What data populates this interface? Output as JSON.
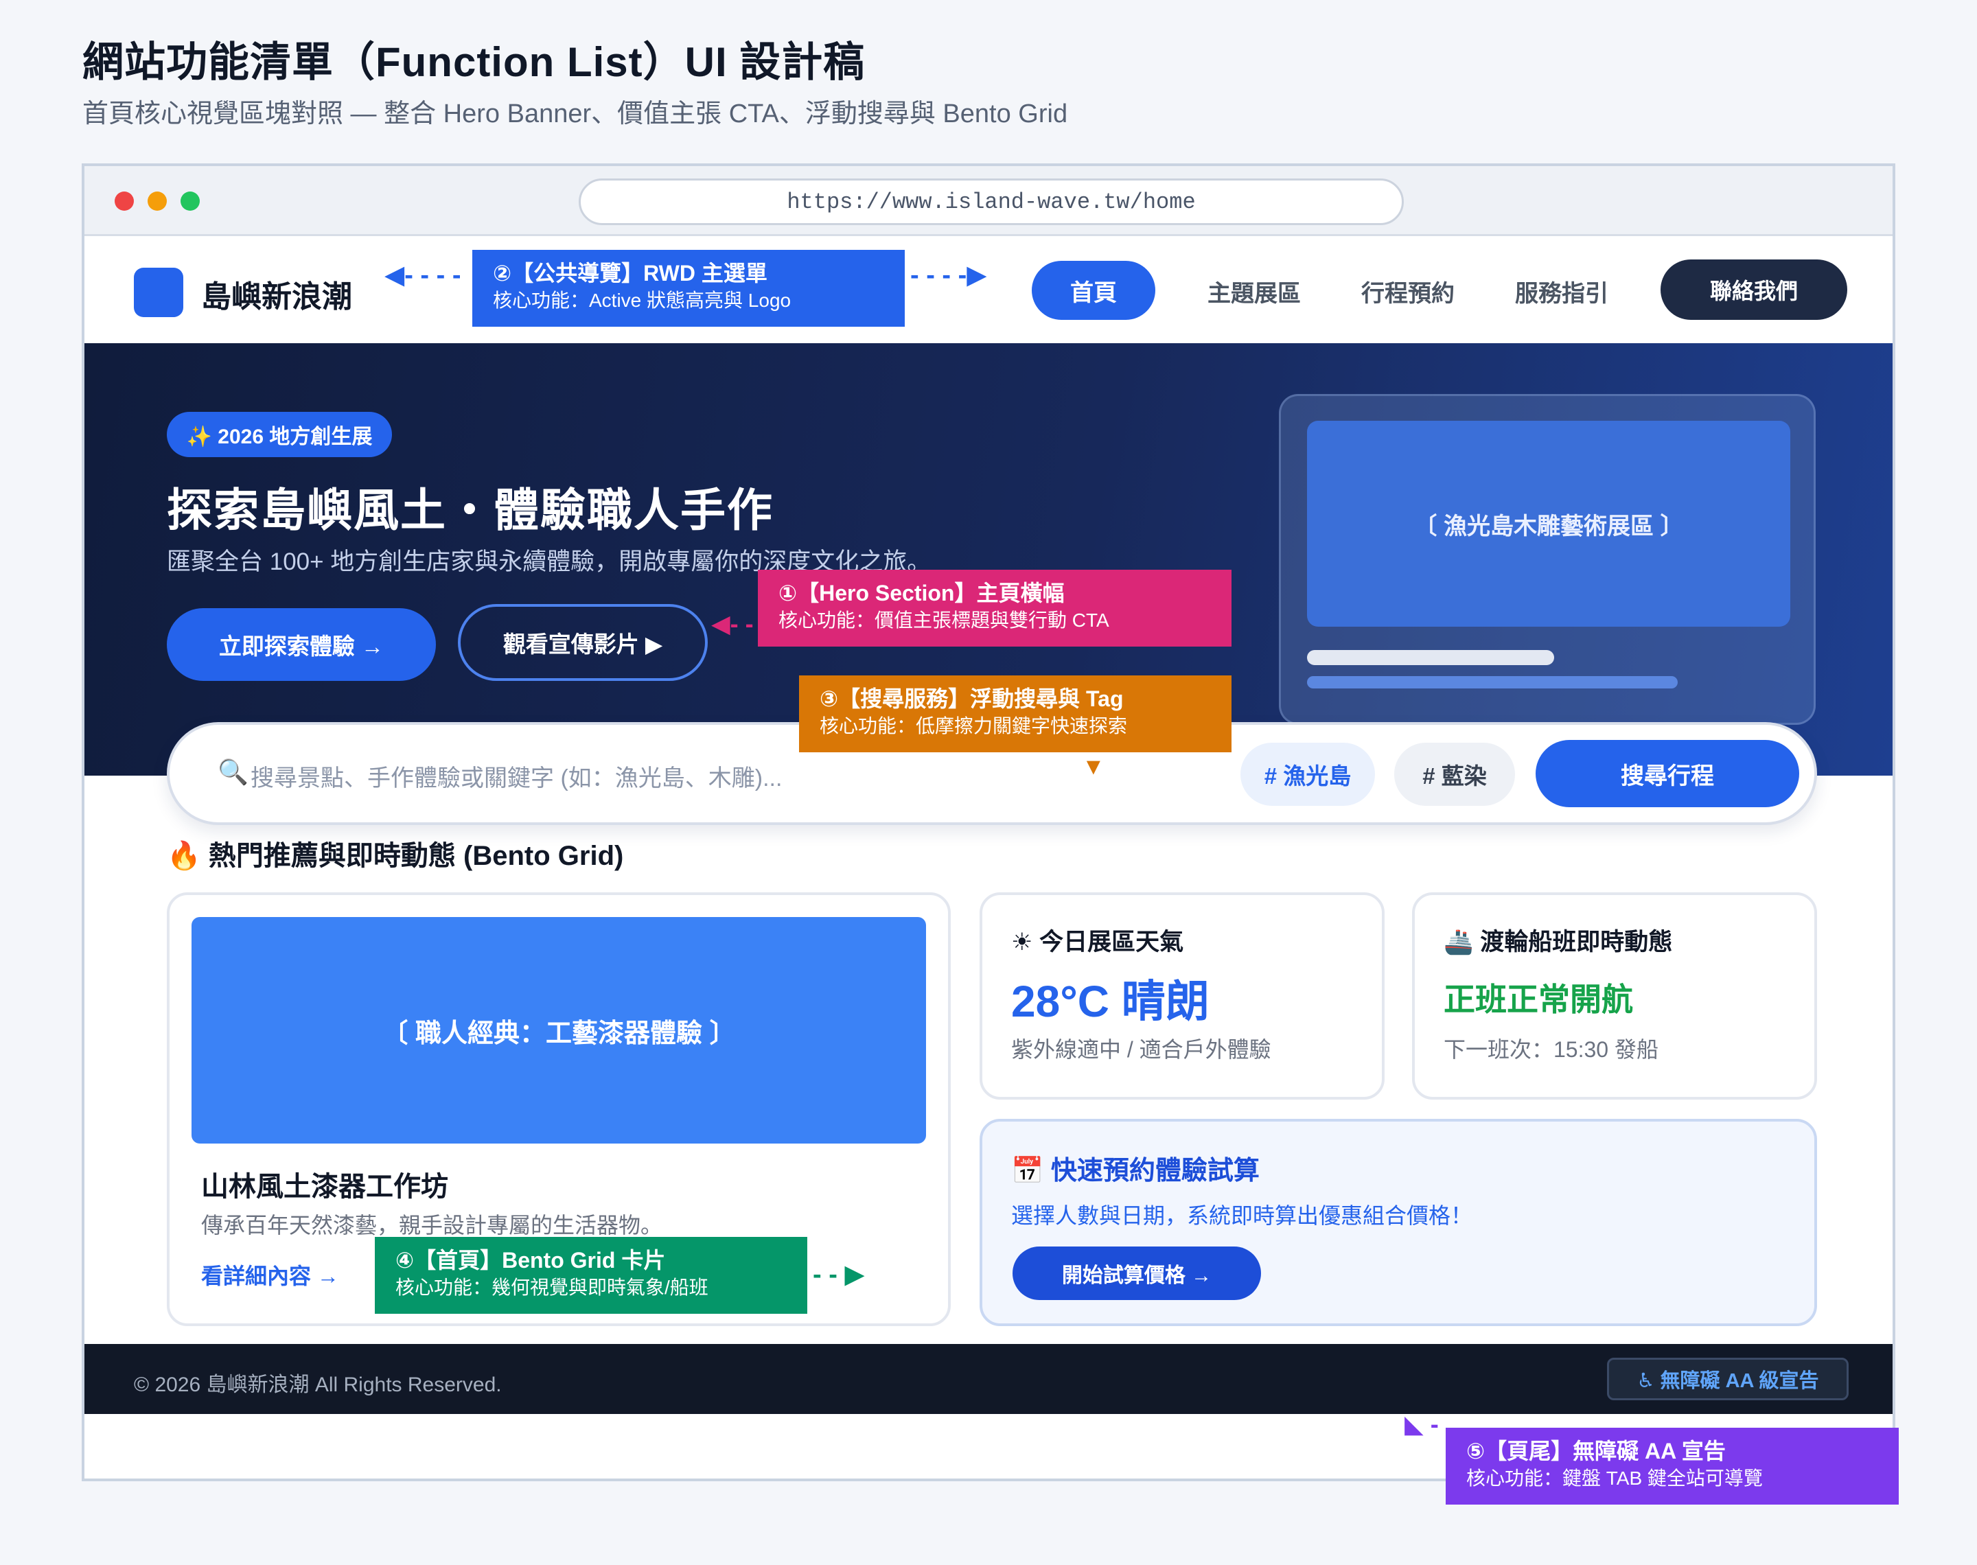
{
  "doc": {
    "title": "網站功能清單（Function List）UI 設計稿",
    "subtitle": "首頁核心視覺區塊對照 — 整合 Hero Banner、價值主張 CTA、浮動搜尋與 Bento Grid"
  },
  "browser": {
    "url": "https://www.island-wave.tw/home"
  },
  "nav": {
    "logo_text": "島嶼新浪潮",
    "items": [
      "首頁",
      "主題展區",
      "行程預約",
      "服務指引"
    ],
    "contact": "聯絡我們"
  },
  "hero": {
    "badge": "✨ 2026 地方創生展",
    "title": "探索島嶼風土・體驗職人手作",
    "desc": "匯聚全台 100+ 地方創生店家與永續體驗，開啟專屬你的深度文化之旅。",
    "cta_primary": "立即探索體驗 →",
    "cta_secondary": "觀看宣傳影片 ▶",
    "card_label": "〔 漁光島木雕藝術展區 〕"
  },
  "search": {
    "placeholder": "搜尋景點、手作體驗或關鍵字 (如：漁光島、木雕)...",
    "tags": [
      "# 漁光島",
      "# 藍染"
    ],
    "button": "搜尋行程"
  },
  "bento": {
    "section_title": "🔥 熱門推薦與即時動態 (Bento Grid)",
    "feature": {
      "image_label": "〔 職人經典：工藝漆器體驗 〕",
      "title": "山林風土漆器工作坊",
      "desc": "傳承百年天然漆藝，親手設計專屬的生活器物。",
      "link": "看詳細內容 →"
    },
    "weather": {
      "title": "☀ 今日展區天氣",
      "value": "28°C 晴朗",
      "note": "紫外線適中 / 適合戶外體驗"
    },
    "ferry": {
      "title": "🚢 渡輪船班即時動態",
      "value": "正班正常開航",
      "note": "下一班次：15:30 發船"
    },
    "booking": {
      "title": "📅 快速預約體驗試算",
      "desc": "選擇人數與日期，系統即時算出優惠組合價格！",
      "button": "開始試算價格 →"
    }
  },
  "footer": {
    "copyright": "© 2026 島嶼新浪潮 All Rights Reserved.",
    "a11y": "♿ 無障礙 AA 級宣告"
  },
  "annotations": {
    "nav": {
      "title": "②【公共導覽】RWD 主選單",
      "sub": "核心功能：Active 狀態高亮與 Logo",
      "color": "#2563eb"
    },
    "hero": {
      "title": "①【Hero Section】主頁橫幅",
      "sub": "核心功能：價值主張標題與雙行動 CTA",
      "color": "#db2777"
    },
    "search": {
      "title": "③【搜尋服務】浮動搜尋與 Tag",
      "sub": "核心功能：低摩擦力關鍵字快速探索",
      "color": "#d97706"
    },
    "bento": {
      "title": "④【首頁】Bento Grid 卡片",
      "sub": "核心功能：幾何視覺與即時氣象/船班",
      "color": "#059669"
    },
    "footer": {
      "title": "⑤【頁尾】無障礙 AA 宣告",
      "sub": "核心功能：鍵盤 TAB 鍵全站可導覽",
      "color": "#7c3aed"
    }
  }
}
